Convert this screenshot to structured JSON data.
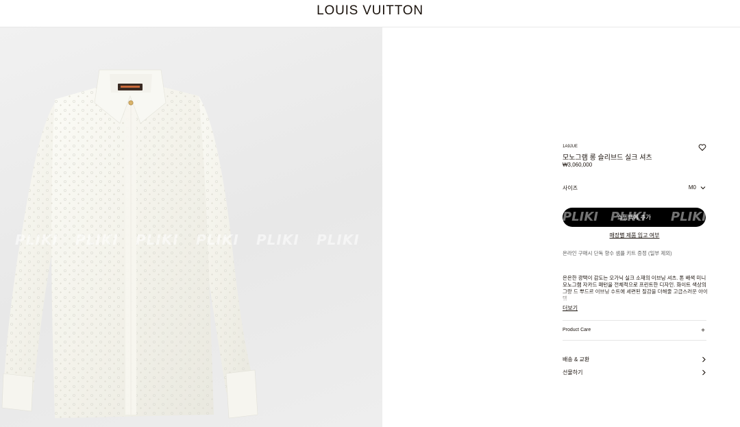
{
  "header": {
    "brand": "LOUIS VUITTON"
  },
  "product": {
    "sku": "1A9JUE",
    "title": "모노그램 롱 슬리브드 실크 셔츠",
    "price": "₩3,060,000",
    "size_label": "사이즈",
    "size_value": "M0",
    "add_to_bag": "쇼핑백에 추가",
    "stock_link": "매장별 제품 입고 여부",
    "promo": "온라인 구매시 단독 향수 샘플 키트 증정 (일부 제외)",
    "description": "은은한 광택이 감도는 오가닉 실크 소재의 이브닝 셔츠. 톤 배색 미니 모노그램 자카드 패턴을 전체적으로 프린트한 디자인. 화이트 색상의 그랑 드 뿌드르 이브닝 수트에 세련된 질감을 더해줄 고급스러운 아이템",
    "more": "더보기",
    "product_care": "Product Care",
    "shipping": "배송 & 교환",
    "gift": "선물하기"
  },
  "watermark": "PLIKI",
  "icons": {
    "wishlist": "heart-icon",
    "size": "chevron-down-icon",
    "care": "plus-icon",
    "links": "chevron-right-icon"
  },
  "colors": {
    "button": "#000000",
    "text": "#19110b",
    "muted": "#5e5e5e",
    "image_bg": "#ececec"
  }
}
